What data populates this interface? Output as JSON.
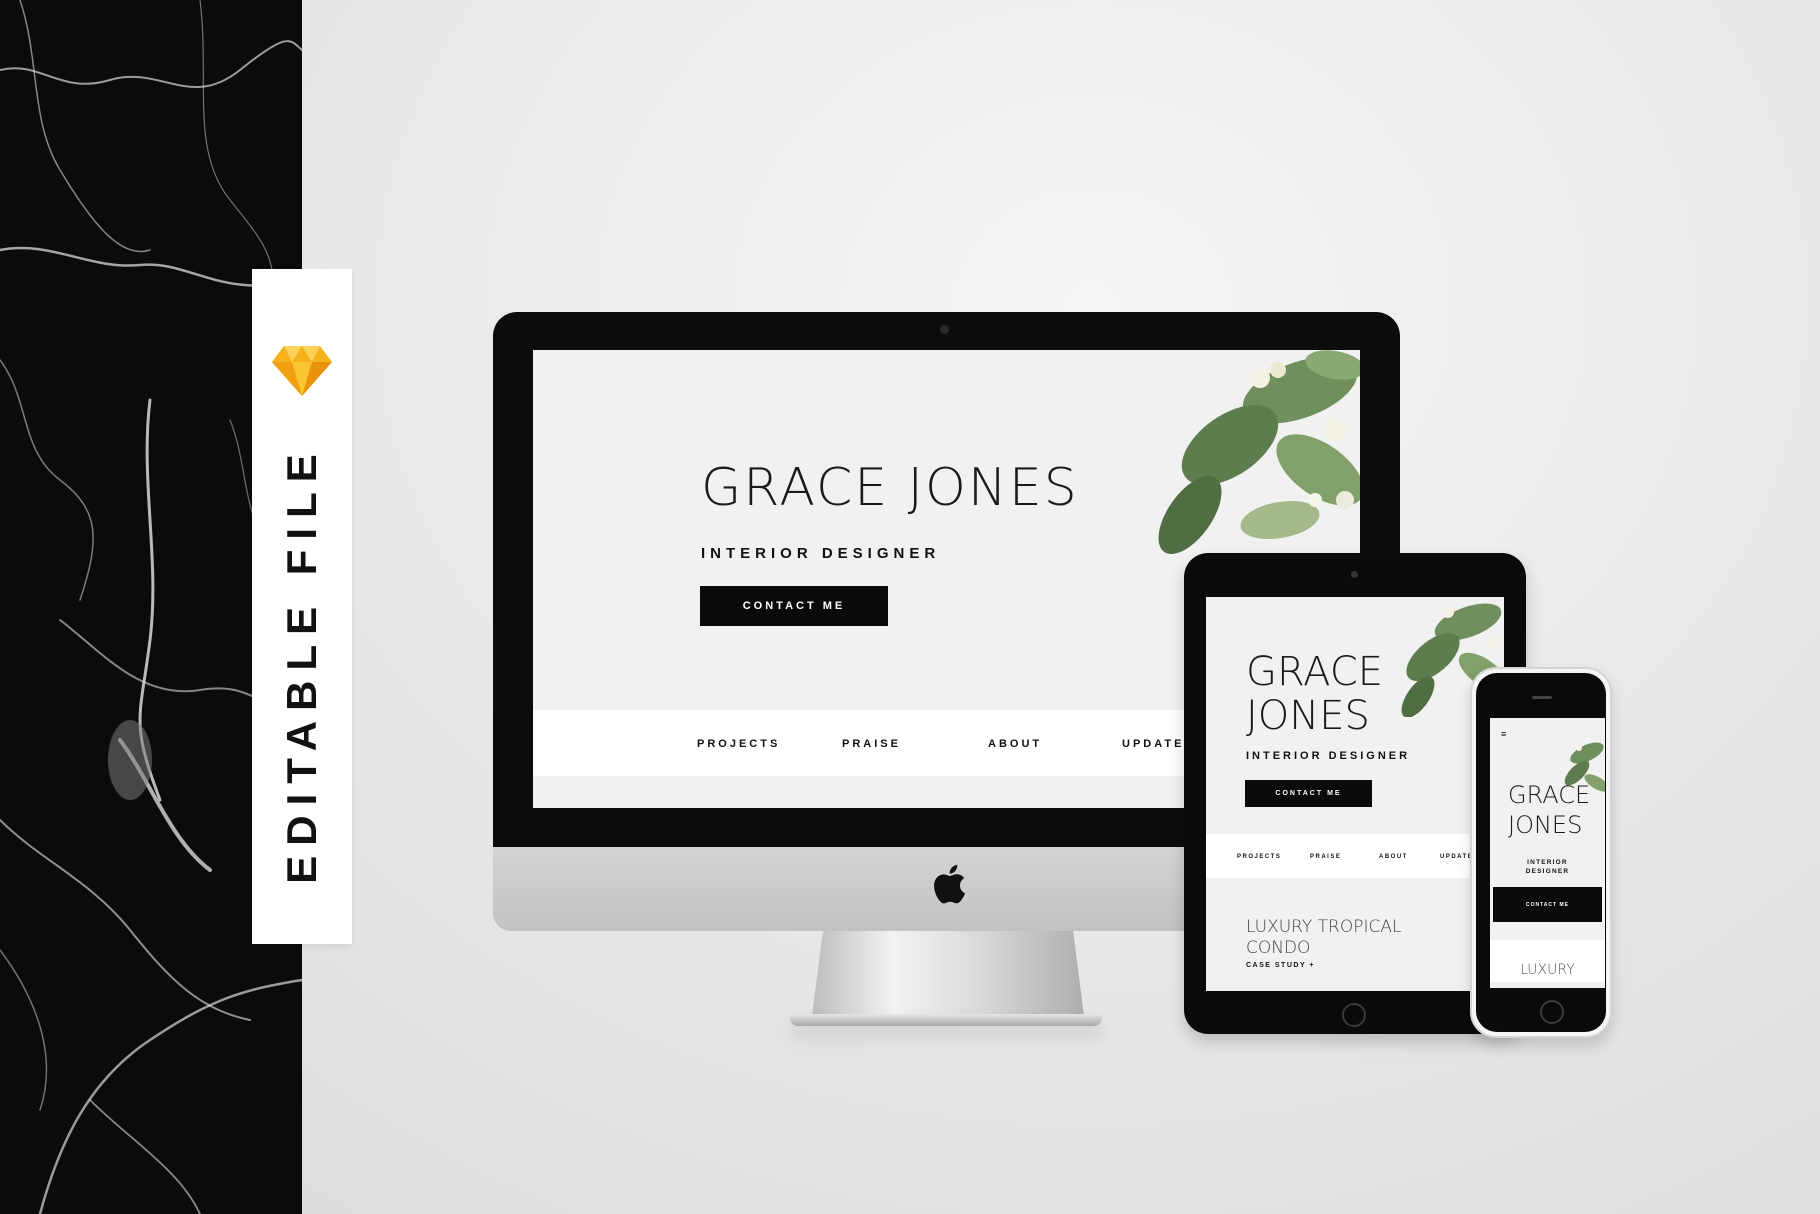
{
  "badge": {
    "label": "EDITABLE FILE",
    "icon": "sketch-diamond-icon"
  },
  "desktop": {
    "name": "GRACE JONES",
    "role": "INTERIOR DESIGNER",
    "contact_label": "CONTACT ME",
    "nav": [
      "PROJECTS",
      "PRAISE",
      "ABOUT",
      "UPDATES"
    ]
  },
  "tablet": {
    "name_line1": "GRACE",
    "name_line2": "JONES",
    "role": "INTERIOR DESIGNER",
    "contact_label": "CONTACT ME",
    "nav": [
      "PROJECTS",
      "PRAISE",
      "ABOUT",
      "UPDATES"
    ],
    "project_title_line1": "LUXURY TROPICAL",
    "project_title_line2": "CONDO",
    "case_study_label": "CASE STUDY +"
  },
  "phone": {
    "menu_icon": "≡",
    "name_line1": "GRACE",
    "name_line2": "JONES",
    "role_line1": "INTERIOR",
    "role_line2": "DESIGNER",
    "contact_label": "CONTACT ME",
    "project_title": "LUXURY"
  },
  "colors": {
    "accent": "#0a0a0a",
    "screen_bg": "#f1f1f1",
    "badge_icon": "#f7b21b"
  }
}
